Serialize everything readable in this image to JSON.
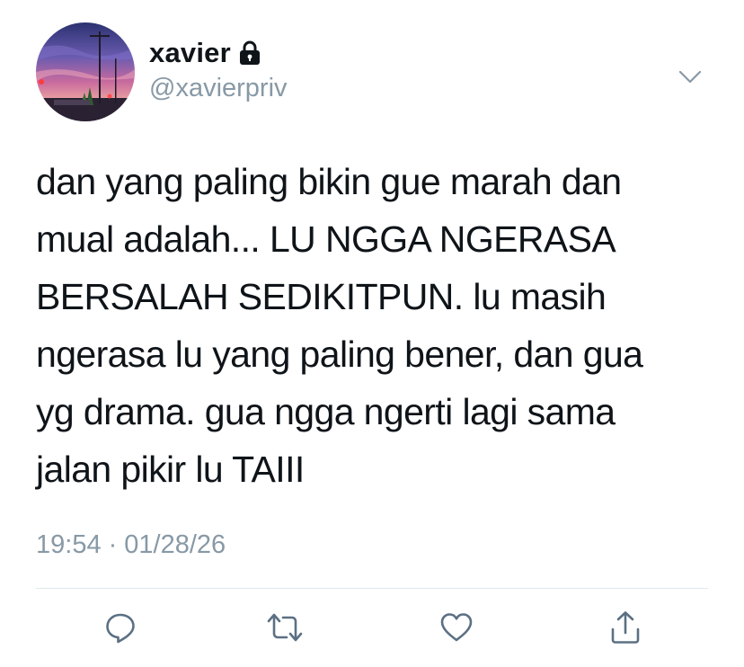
{
  "user": {
    "display_name": "xavier",
    "handle": "@xavierpriv",
    "avatar": "sunset-street-photo",
    "protected_icon": "lock-icon"
  },
  "tweet": {
    "lines": [
      "dan yang paling bikin gue marah dan",
      "mual adalah... LU NGGA NGERASA",
      "BERSALAH SEDIKITPUN. lu masih",
      "ngerasa lu yang paling bener, dan gua",
      "yg drama. gua ngga ngerti lagi sama",
      "jalan pikir lu TAIII"
    ],
    "time": "19:54",
    "separator": "·",
    "date": "01/28/26"
  },
  "actions": {
    "reply_icon": "reply-icon",
    "retweet_icon": "retweet-icon",
    "like_icon": "heart-icon",
    "share_icon": "share-icon"
  },
  "colors": {
    "text": "#0f1419",
    "secondary": "#8899a6",
    "divider": "#e1e8ed",
    "background": "#ffffff"
  }
}
